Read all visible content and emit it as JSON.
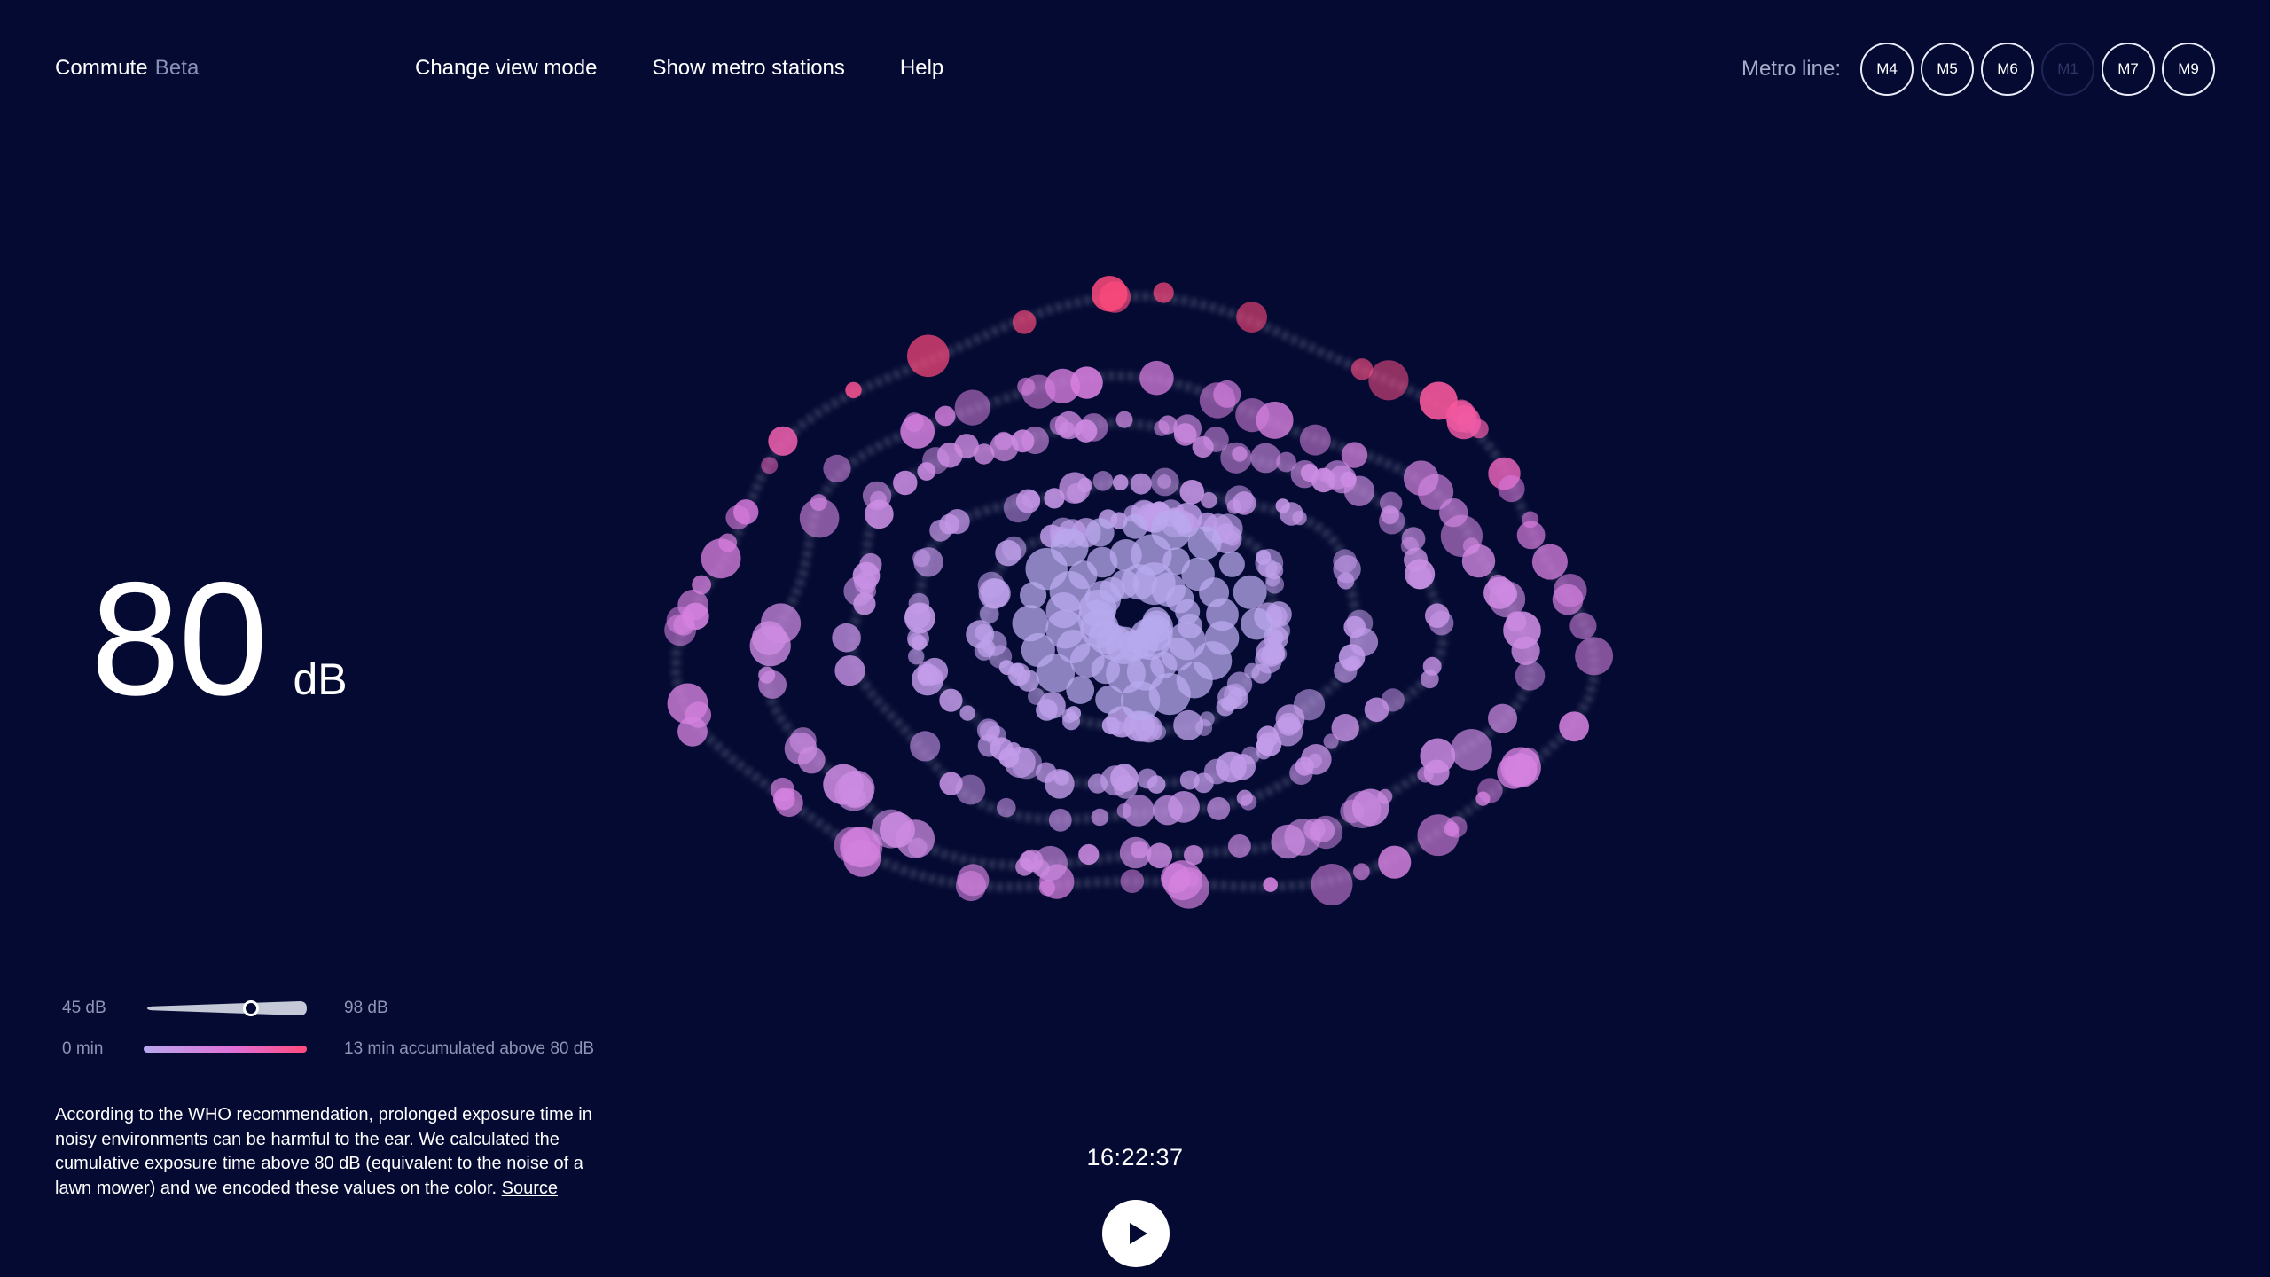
{
  "brand": {
    "name": "Commute",
    "tag": "Beta"
  },
  "nav": {
    "view_mode": "Change view mode",
    "stations": "Show metro stations",
    "help": "Help"
  },
  "metro": {
    "label": "Metro line:",
    "lines": [
      {
        "label": "M4",
        "active": true
      },
      {
        "label": "M5",
        "active": true
      },
      {
        "label": "M6",
        "active": true
      },
      {
        "label": "M1",
        "active": false
      },
      {
        "label": "M7",
        "active": true
      },
      {
        "label": "M9",
        "active": true
      }
    ]
  },
  "readout": {
    "value": "80",
    "unit": "dB"
  },
  "legend": {
    "db_min": "45 dB",
    "db_max": "98 dB",
    "db_current_fraction": 0.66,
    "time_min": "0 min",
    "time_caption": "13 min accumulated above 80 dB"
  },
  "info": {
    "text": "According to the WHO recommendation, prolonged exposure time in noisy environments can be harmful to the ear. We calculated the cumulative exposure time above 80 dB (equivalent to the noise of a lawn mower) and we encoded these values on the color. ",
    "link": "Source"
  },
  "player": {
    "time": "16:22:37"
  },
  "colors": {
    "background": "#050a33",
    "loud": "#ff4a7d",
    "mid": "#e070d8",
    "quiet": "#b8a9ee",
    "trail": "#6f7890"
  },
  "icons": {
    "play": "play-icon"
  }
}
